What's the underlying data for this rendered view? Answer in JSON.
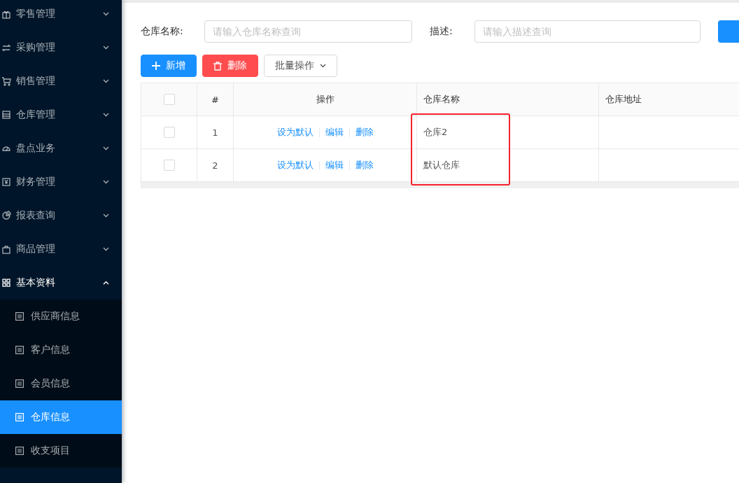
{
  "sidebar": {
    "items": [
      {
        "label": "零售管理",
        "expanded": false
      },
      {
        "label": "采购管理",
        "expanded": false
      },
      {
        "label": "销售管理",
        "expanded": false
      },
      {
        "label": "仓库管理",
        "expanded": false
      },
      {
        "label": "盘点业务",
        "expanded": false
      },
      {
        "label": "财务管理",
        "expanded": false
      },
      {
        "label": "报表查询",
        "expanded": false
      },
      {
        "label": "商品管理",
        "expanded": false
      },
      {
        "label": "基本资料",
        "expanded": true,
        "children": [
          {
            "label": "供应商信息",
            "selected": false
          },
          {
            "label": "客户信息",
            "selected": false
          },
          {
            "label": "会员信息",
            "selected": false
          },
          {
            "label": "仓库信息",
            "selected": true
          },
          {
            "label": "收支项目",
            "selected": false
          }
        ]
      }
    ]
  },
  "search": {
    "fields": [
      {
        "label": "仓库名称:",
        "placeholder": "请输入仓库名称查询"
      },
      {
        "label": "描述:",
        "placeholder": "请输入描述查询"
      }
    ]
  },
  "toolbar": {
    "buttons": [
      {
        "label": "新增",
        "kind": "primary"
      },
      {
        "label": "删除",
        "kind": "danger"
      },
      {
        "label": "批量操作",
        "kind": "dropdown"
      }
    ]
  },
  "table": {
    "header_checked": false,
    "columns": [
      {
        "label": "#",
        "highlighted": false
      },
      {
        "label": "操作",
        "highlighted": false
      },
      {
        "label": "仓库名称",
        "highlighted": true
      },
      {
        "label": "仓库地址",
        "highlighted": false
      }
    ],
    "rows": [
      {
        "checked": false,
        "index": "1",
        "actions": [
          "设为默认",
          "编辑",
          "删除"
        ],
        "name": "仓库2"
      },
      {
        "checked": false,
        "index": "2",
        "actions": [
          "设为默认",
          "编辑",
          "删除"
        ],
        "name": "默认仓库"
      }
    ]
  }
}
